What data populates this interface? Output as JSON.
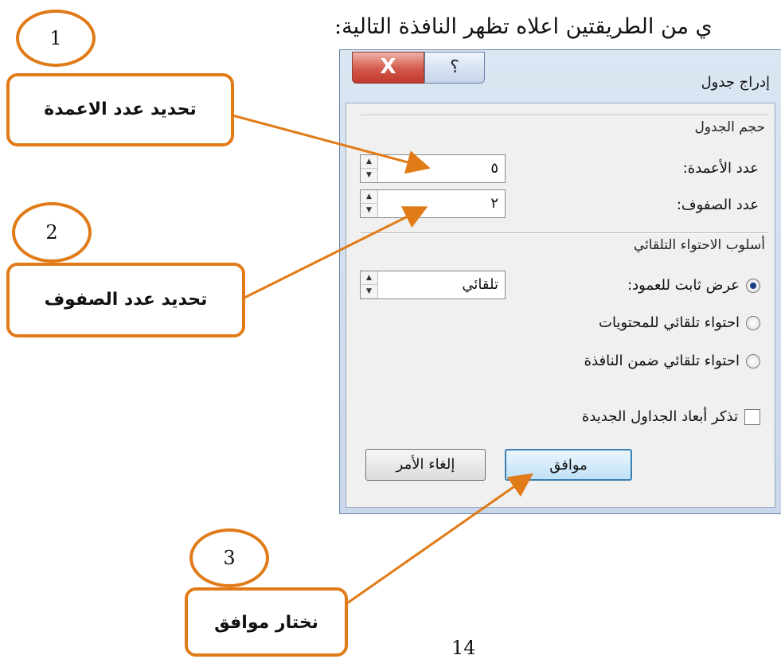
{
  "top_text": "ي من الطريقتين اعلاه تظهر النافذة التالية:",
  "page_number": "14",
  "dialog": {
    "title": "إدراج جدول",
    "close_label": "X",
    "help_label": "؟",
    "table_size_section": "حجم الجدول",
    "columns_label": "عدد الأعمدة:",
    "columns_value": "٥",
    "rows_label": "عدد الصفوف:",
    "rows_value": "٢",
    "autofit_section": "أسلوب الاحتواء التلقائي",
    "fixed_width_option": "عرض ثابت للعمود:",
    "fixed_width_value": "تلقائي",
    "autofit_contents_option": "احتواء تلقائي للمحتويات",
    "autofit_window_option": "احتواء تلقائي ضمن النافذة",
    "remember_dimensions_label": "تذكر أبعاد الجداول الجديدة",
    "ok_label": "موافق",
    "cancel_label": "إلغاء الأمر"
  },
  "callouts": [
    {
      "number": "1",
      "text": "تحديد عدد الاعمدة"
    },
    {
      "number": "2",
      "text": "تحديد عدد الصفوف"
    },
    {
      "number": "3",
      "text": "نختار موافق"
    }
  ],
  "colors": {
    "callout_border": "#e07b17",
    "ok_border": "#3c7fb1",
    "close_red": "#c0392b"
  }
}
